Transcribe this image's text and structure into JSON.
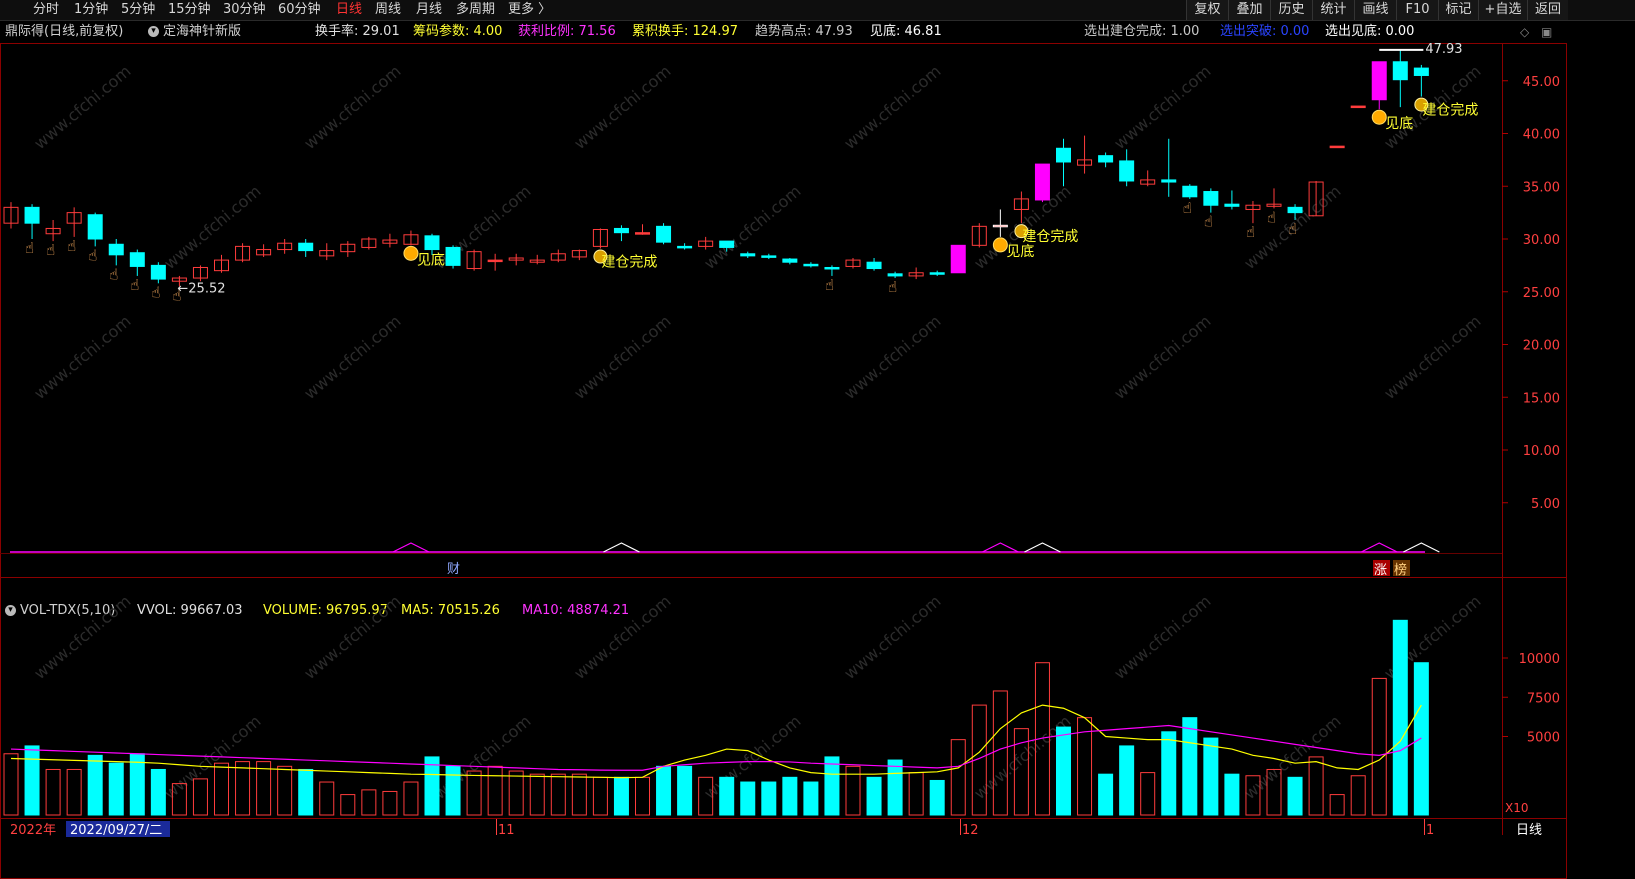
{
  "toolbar": {
    "left_items": [
      "分时",
      "1分钟",
      "5分钟",
      "15分钟",
      "30分钟",
      "60分钟",
      "日线",
      "周线",
      "月线",
      "多周期",
      "更多 〉"
    ],
    "active_label": "日线",
    "right_items": [
      "复权",
      "叠加",
      "历史",
      "统计",
      "画线",
      "F10",
      "标记",
      "+自选",
      "返回"
    ]
  },
  "info": {
    "stock": "鼎际得(日线,前复权)",
    "indicator": "定海神针新版",
    "turnover": "换手率: 29.01",
    "chip_param": "筹码参数: 4.00",
    "profit_ratio": "获利比例: 71.56",
    "cum_turnover": "累积换手: 124.97",
    "trend_high": "趋势高点: 47.93",
    "bottom_val": "见底: 46.81",
    "sel_build": "选出建仓完成: 1.00",
    "sel_break": "选出突破: 0.00",
    "sel_bottom": "选出见底: 0.00"
  },
  "volume_panel": {
    "name": "VOL-TDX(5,10)",
    "vvol": "VVOL: 99667.03",
    "volume": "VOLUME: 96795.97",
    "ma5": "MA5: 70515.26",
    "ma10": "MA10: 48874.21",
    "scale_note": "X10",
    "y_ticks": [
      "10000",
      "7500",
      "5000"
    ]
  },
  "price_axis": {
    "ticks": [
      "45.00",
      "40.00",
      "35.00",
      "30.00",
      "25.00",
      "20.00",
      "15.00",
      "10.00",
      "5.00"
    ],
    "range": [
      0,
      50
    ]
  },
  "annotations": {
    "low_label": "←25.52",
    "high_label": "47.93",
    "bottom_text": "见底",
    "build_text": "建仓完成",
    "finance_mark": "财",
    "tag_zhang": "涨",
    "tag_bang": "榜",
    "watermark": "www.cfchi.com"
  },
  "date_axis": {
    "year": "2022年",
    "cursor_date": "2022/09/27/二",
    "month_11": "11",
    "month_12": "12",
    "month_1": "1",
    "period": "日线"
  },
  "colors": {
    "up": "#ff3c3c",
    "down": "#00ffff",
    "limit_up": "#ff00ff",
    "ma5": "#ffff00",
    "ma10": "#ff00ff",
    "signal": "#ffff33",
    "grid": "#8b0000"
  },
  "chart_data": {
    "type": "candlestick",
    "candles": [
      {
        "o": 31.5,
        "c": 33.0,
        "h": 33.5,
        "l": 31.0
      },
      {
        "o": 33.0,
        "c": 31.5,
        "h": 33.3,
        "l": 30.0
      },
      {
        "o": 30.5,
        "c": 31.0,
        "h": 31.8,
        "l": 29.8
      },
      {
        "o": 31.5,
        "c": 32.5,
        "h": 33.0,
        "l": 30.2
      },
      {
        "o": 32.3,
        "c": 30.0,
        "h": 32.5,
        "l": 29.3
      },
      {
        "o": 29.5,
        "c": 28.5,
        "h": 30.0,
        "l": 27.5
      },
      {
        "o": 28.7,
        "c": 27.4,
        "h": 29.0,
        "l": 26.5
      },
      {
        "o": 27.5,
        "c": 26.2,
        "h": 27.8,
        "l": 25.8
      },
      {
        "o": 26.0,
        "c": 26.3,
        "h": 26.5,
        "l": 25.52
      },
      {
        "o": 26.3,
        "c": 27.3,
        "h": 27.5,
        "l": 26.0
      },
      {
        "o": 27.0,
        "c": 28.0,
        "h": 28.5,
        "l": 26.8
      },
      {
        "o": 28.0,
        "c": 29.3,
        "h": 29.6,
        "l": 27.8
      },
      {
        "o": 28.5,
        "c": 29.0,
        "h": 29.5,
        "l": 28.3
      },
      {
        "o": 29.0,
        "c": 29.6,
        "h": 30.0,
        "l": 28.6
      },
      {
        "o": 29.6,
        "c": 28.9,
        "h": 30.0,
        "l": 28.3
      },
      {
        "o": 28.4,
        "c": 28.9,
        "h": 29.6,
        "l": 28.0
      },
      {
        "o": 28.8,
        "c": 29.5,
        "h": 29.8,
        "l": 28.3
      },
      {
        "o": 29.2,
        "c": 30.0,
        "h": 30.2,
        "l": 29.0
      },
      {
        "o": 29.6,
        "c": 29.9,
        "h": 30.5,
        "l": 29.2
      },
      {
        "o": 29.5,
        "c": 30.4,
        "h": 30.8,
        "l": 29.4
      },
      {
        "o": 30.3,
        "c": 29.0,
        "h": 30.5,
        "l": 28.5
      },
      {
        "o": 29.2,
        "c": 27.5,
        "h": 29.4,
        "l": 27.2
      },
      {
        "o": 27.2,
        "c": 28.8,
        "h": 29.0,
        "l": 27.0
      },
      {
        "o": 28.0,
        "c": 28.0,
        "h": 28.6,
        "l": 27.0
      },
      {
        "o": 28.0,
        "c": 28.2,
        "h": 28.6,
        "l": 27.5
      },
      {
        "o": 27.8,
        "c": 28.0,
        "h": 28.5,
        "l": 27.6
      },
      {
        "o": 28.0,
        "c": 28.6,
        "h": 29.0,
        "l": 27.8
      },
      {
        "o": 28.3,
        "c": 28.9,
        "h": 29.0,
        "l": 28.0
      },
      {
        "o": 29.3,
        "c": 30.9,
        "h": 31.0,
        "l": 29.1
      },
      {
        "o": 31.0,
        "c": 30.6,
        "h": 31.3,
        "l": 29.8
      },
      {
        "o": 30.6,
        "c": 30.6,
        "h": 31.4,
        "l": 30.4
      },
      {
        "o": 31.2,
        "c": 29.7,
        "h": 31.5,
        "l": 29.5
      },
      {
        "o": 29.3,
        "c": 29.2,
        "h": 29.6,
        "l": 29.0
      },
      {
        "o": 29.3,
        "c": 29.8,
        "h": 30.2,
        "l": 29.0
      },
      {
        "o": 29.8,
        "c": 29.2,
        "h": 29.8,
        "l": 28.8
      },
      {
        "o": 28.6,
        "c": 28.4,
        "h": 28.8,
        "l": 28.2
      },
      {
        "o": 28.4,
        "c": 28.3,
        "h": 28.6,
        "l": 28.1
      },
      {
        "o": 28.1,
        "c": 27.8,
        "h": 28.2,
        "l": 27.6
      },
      {
        "o": 27.6,
        "c": 27.5,
        "h": 27.8,
        "l": 27.3
      },
      {
        "o": 27.3,
        "c": 27.2,
        "h": 27.5,
        "l": 26.5
      },
      {
        "o": 27.4,
        "c": 28.0,
        "h": 28.2,
        "l": 27.2
      },
      {
        "o": 27.8,
        "c": 27.2,
        "h": 28.2,
        "l": 27.0
      },
      {
        "o": 26.7,
        "c": 26.5,
        "h": 26.9,
        "l": 26.3
      },
      {
        "o": 26.5,
        "c": 26.8,
        "h": 27.3,
        "l": 26.2
      },
      {
        "o": 26.8,
        "c": 26.7,
        "h": 27.0,
        "l": 26.5
      },
      {
        "o": 26.8,
        "c": 29.4,
        "h": 29.4,
        "l": 26.8
      },
      {
        "o": 29.4,
        "c": 31.2,
        "h": 31.5,
        "l": 29.2
      },
      {
        "o": 31.3,
        "c": 31.3,
        "h": 32.8,
        "l": 30.2
      },
      {
        "o": 32.8,
        "c": 33.8,
        "h": 34.5,
        "l": 31.5
      },
      {
        "o": 33.7,
        "c": 37.1,
        "h": 37.1,
        "l": 33.5
      },
      {
        "o": 38.6,
        "c": 37.3,
        "h": 39.5,
        "l": 35.0
      },
      {
        "o": 37.0,
        "c": 37.5,
        "h": 39.8,
        "l": 36.2
      },
      {
        "o": 37.9,
        "c": 37.3,
        "h": 38.2,
        "l": 36.8
      },
      {
        "o": 37.4,
        "c": 35.5,
        "h": 38.5,
        "l": 35.0
      },
      {
        "o": 35.2,
        "c": 35.6,
        "h": 36.5,
        "l": 35.0
      },
      {
        "o": 35.6,
        "c": 35.4,
        "h": 39.5,
        "l": 34.0
      },
      {
        "o": 35.0,
        "c": 34.0,
        "h": 35.2,
        "l": 33.8
      },
      {
        "o": 34.5,
        "c": 33.2,
        "h": 34.8,
        "l": 32.5
      },
      {
        "o": 33.3,
        "c": 33.1,
        "h": 34.6,
        "l": 32.8
      },
      {
        "o": 32.8,
        "c": 33.2,
        "h": 33.6,
        "l": 31.5
      },
      {
        "o": 33.1,
        "c": 33.3,
        "h": 34.8,
        "l": 32.9
      },
      {
        "o": 33.0,
        "c": 32.5,
        "h": 33.3,
        "l": 31.8
      },
      {
        "o": 32.2,
        "c": 35.4,
        "h": 35.5,
        "l": 32.2
      },
      {
        "o": 38.8,
        "c": 38.8,
        "h": 38.8,
        "l": 38.8
      },
      {
        "o": 42.6,
        "c": 42.6,
        "h": 42.6,
        "l": 42.6
      },
      {
        "o": 43.2,
        "c": 46.8,
        "h": 46.8,
        "l": 42.3
      },
      {
        "o": 46.8,
        "c": 45.1,
        "h": 47.93,
        "l": 42.5
      },
      {
        "o": 46.2,
        "c": 45.5,
        "h": 46.5,
        "l": 43.5
      }
    ],
    "volumes": [
      3900,
      4400,
      2900,
      2900,
      3800,
      3300,
      3900,
      2900,
      2000,
      2300,
      3300,
      3400,
      3400,
      3100,
      2900,
      2100,
      1300,
      1600,
      1500,
      2100,
      3700,
      3100,
      2800,
      3100,
      2800,
      2600,
      2600,
      2600,
      2400,
      2400,
      2400,
      3100,
      3100,
      2400,
      2400,
      2100,
      2100,
      2400,
      2100,
      3700,
      3100,
      2400,
      3500,
      2700,
      2200,
      4800,
      7000,
      7900,
      5500,
      9700,
      5600,
      6200,
      2600,
      4400,
      2700,
      5300,
      6200,
      4900,
      2600,
      2500,
      2900,
      2400,
      3700,
      1300,
      2500,
      8700,
      12400,
      9700
    ],
    "ma5_line": [
      3600,
      3560,
      3520,
      3480,
      3440,
      3400,
      3360,
      3300,
      3200,
      3100,
      3050,
      3000,
      2950,
      2900,
      2850,
      2800,
      2750,
      2700,
      2650,
      2600,
      2580,
      2550,
      2520,
      2500,
      2480,
      2460,
      2440,
      2420,
      2400,
      2380,
      2400,
      3100,
      3500,
      3800,
      4200,
      4100,
      3500,
      3000,
      2700,
      2600,
      2600,
      2600,
      2650,
      2700,
      2750,
      3000,
      4000,
      5500,
      6500,
      7000,
      6800,
      6200,
      5000,
      4900,
      4800,
      4800,
      4600,
      4400,
      4200,
      3800,
      3600,
      3300,
      3400,
      3000,
      2900,
      3500,
      4700,
      7000
    ],
    "ma10_line": [
      4200,
      4150,
      4100,
      4050,
      4000,
      3950,
      3900,
      3850,
      3800,
      3750,
      3700,
      3650,
      3600,
      3550,
      3500,
      3450,
      3400,
      3350,
      3300,
      3250,
      3200,
      3150,
      3100,
      3050,
      3000,
      2950,
      2900,
      2880,
      2860,
      2850,
      2850,
      3100,
      3200,
      3300,
      3350,
      3400,
      3400,
      3380,
      3300,
      3250,
      3200,
      3150,
      3100,
      3050,
      3000,
      3100,
      3600,
      4200,
      4600,
      4900,
      5100,
      5300,
      5400,
      5500,
      5600,
      5700,
      5500,
      5300,
      5100,
      4900,
      4700,
      4500,
      4300,
      4100,
      3900,
      3800,
      4100,
      4900
    ],
    "signals": {
      "hand": [
        1,
        2,
        3,
        4,
        5,
        6,
        7,
        8,
        39,
        42,
        56,
        57,
        59,
        60,
        61
      ],
      "bottom": [
        19,
        47,
        65
      ],
      "build": [
        28,
        48,
        67
      ]
    },
    "x_label_months": [
      "11",
      "12",
      "1"
    ],
    "y_ticks_price": [
      45,
      40,
      35,
      30,
      25,
      20,
      15,
      10,
      5
    ],
    "y_ticks_volume": [
      10000,
      7500,
      5000
    ]
  }
}
